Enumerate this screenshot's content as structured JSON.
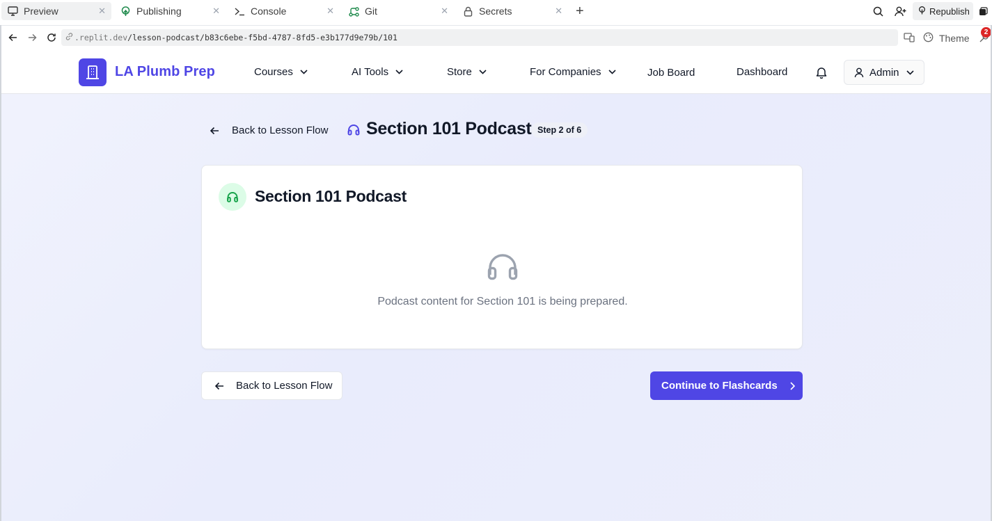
{
  "tabs": [
    {
      "label": "Preview",
      "icon": "monitor-icon",
      "active": true
    },
    {
      "label": "Publishing",
      "icon": "publishing-icon",
      "active": false
    },
    {
      "label": "Console",
      "icon": "terminal-icon",
      "active": false
    },
    {
      "label": "Git",
      "icon": "git-icon",
      "active": false
    },
    {
      "label": "Secrets",
      "icon": "lock-icon",
      "active": false
    }
  ],
  "toolbar": {
    "republish_label": "Republish",
    "theme_label": "Theme",
    "notification_count": "2"
  },
  "address": {
    "url_domain": ".replit.dev",
    "url_path": "/lesson-podcast/b83c6ebe-f5bd-4787-8fd5-e3b177d9e79b/101"
  },
  "site": {
    "brand": "LA Plumb Prep",
    "nav": [
      "Courses",
      "AI Tools",
      "Store",
      "For Companies",
      "Job Board",
      "Dashboard"
    ],
    "admin_label": "Admin"
  },
  "page": {
    "back_label": "Back to Lesson Flow",
    "title": "Section 101 Podcast",
    "step": "Step 2 of 6"
  },
  "card": {
    "title": "Section 101 Podcast",
    "message": "Podcast content for Section 101 is being prepared."
  },
  "actions": {
    "back_label": "Back to Lesson Flow",
    "continue_label": "Continue to Flashcards"
  },
  "colors": {
    "accent": "#4f46e5",
    "podcast_icon_bg": "#dcfce7",
    "podcast_icon": "#16a34a",
    "muted_text": "#6b7280"
  }
}
